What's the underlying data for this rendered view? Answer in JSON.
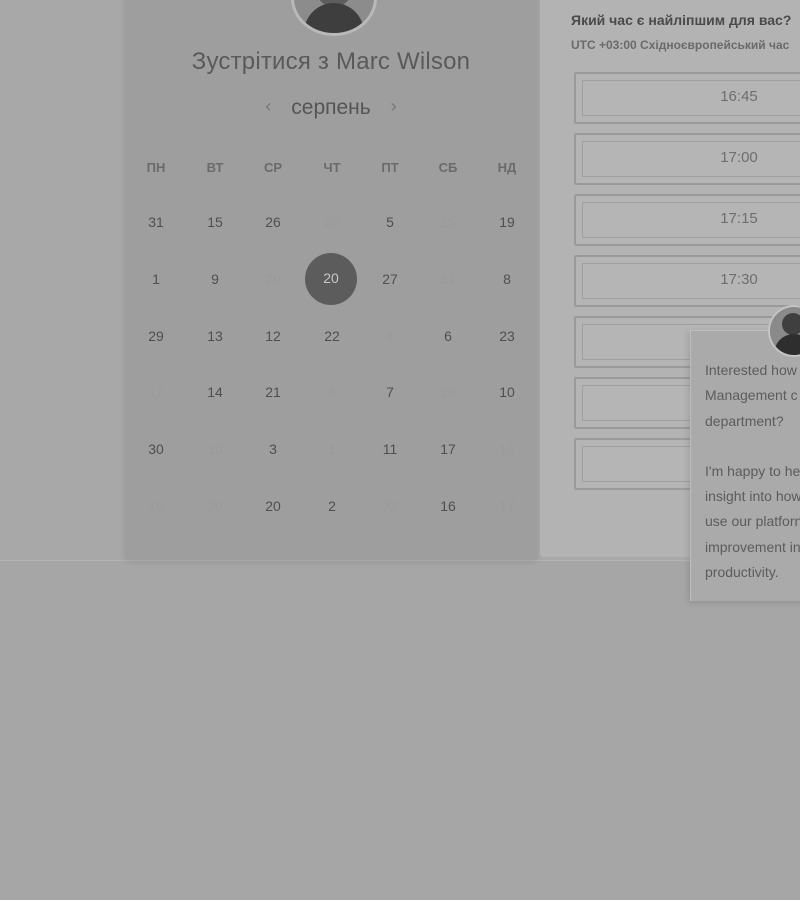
{
  "calendar": {
    "title": "Зустрітися з Marc Wilson",
    "month": "серпень",
    "prev_icon": "chevron-left-icon",
    "next_icon": "chevron-right-icon",
    "weekdays": [
      "ПН",
      "ВТ",
      "СР",
      "ЧТ",
      "ПТ",
      "СБ",
      "НД"
    ],
    "rows": [
      [
        "31",
        "15",
        "26",
        "28",
        "5",
        "25",
        "19"
      ],
      [
        "1",
        "9",
        "20",
        "20",
        "27",
        "31",
        "8"
      ],
      [
        "29",
        "13",
        "12",
        "22",
        "4",
        "6",
        "23"
      ],
      [
        "17",
        "14",
        "21",
        "6",
        "7",
        "28",
        "10"
      ],
      [
        "30",
        "10",
        "3",
        "1",
        "11",
        "17",
        "14"
      ],
      [
        "16",
        "20",
        "20",
        "2",
        "22",
        "16",
        "17"
      ]
    ],
    "muted": [
      [
        false,
        false,
        false,
        true,
        false,
        true,
        false
      ],
      [
        false,
        false,
        true,
        false,
        false,
        true,
        false
      ],
      [
        false,
        false,
        false,
        false,
        true,
        false,
        false
      ],
      [
        true,
        false,
        false,
        true,
        false,
        true,
        false
      ],
      [
        false,
        true,
        false,
        true,
        false,
        false,
        true
      ],
      [
        true,
        true,
        false,
        false,
        true,
        false,
        true
      ]
    ],
    "selected": "20"
  },
  "time_panel": {
    "title": "Який час є найліпшим для вас?",
    "timezone": "UTC +03:00 Східноєвропейський час",
    "slots": [
      "16:45",
      "17:00",
      "17:15",
      "17:30",
      "",
      "",
      ""
    ]
  },
  "chat": {
    "lines_1": [
      "Interested how",
      "Management c",
      "department?"
    ],
    "lines_2": [
      "I'm happy to he",
      "insight into how",
      "use our platforn",
      "improvement in",
      "productivity."
    ]
  },
  "colors": {
    "background": "#a6a6a6",
    "selected_day": "#5c5c5c"
  }
}
